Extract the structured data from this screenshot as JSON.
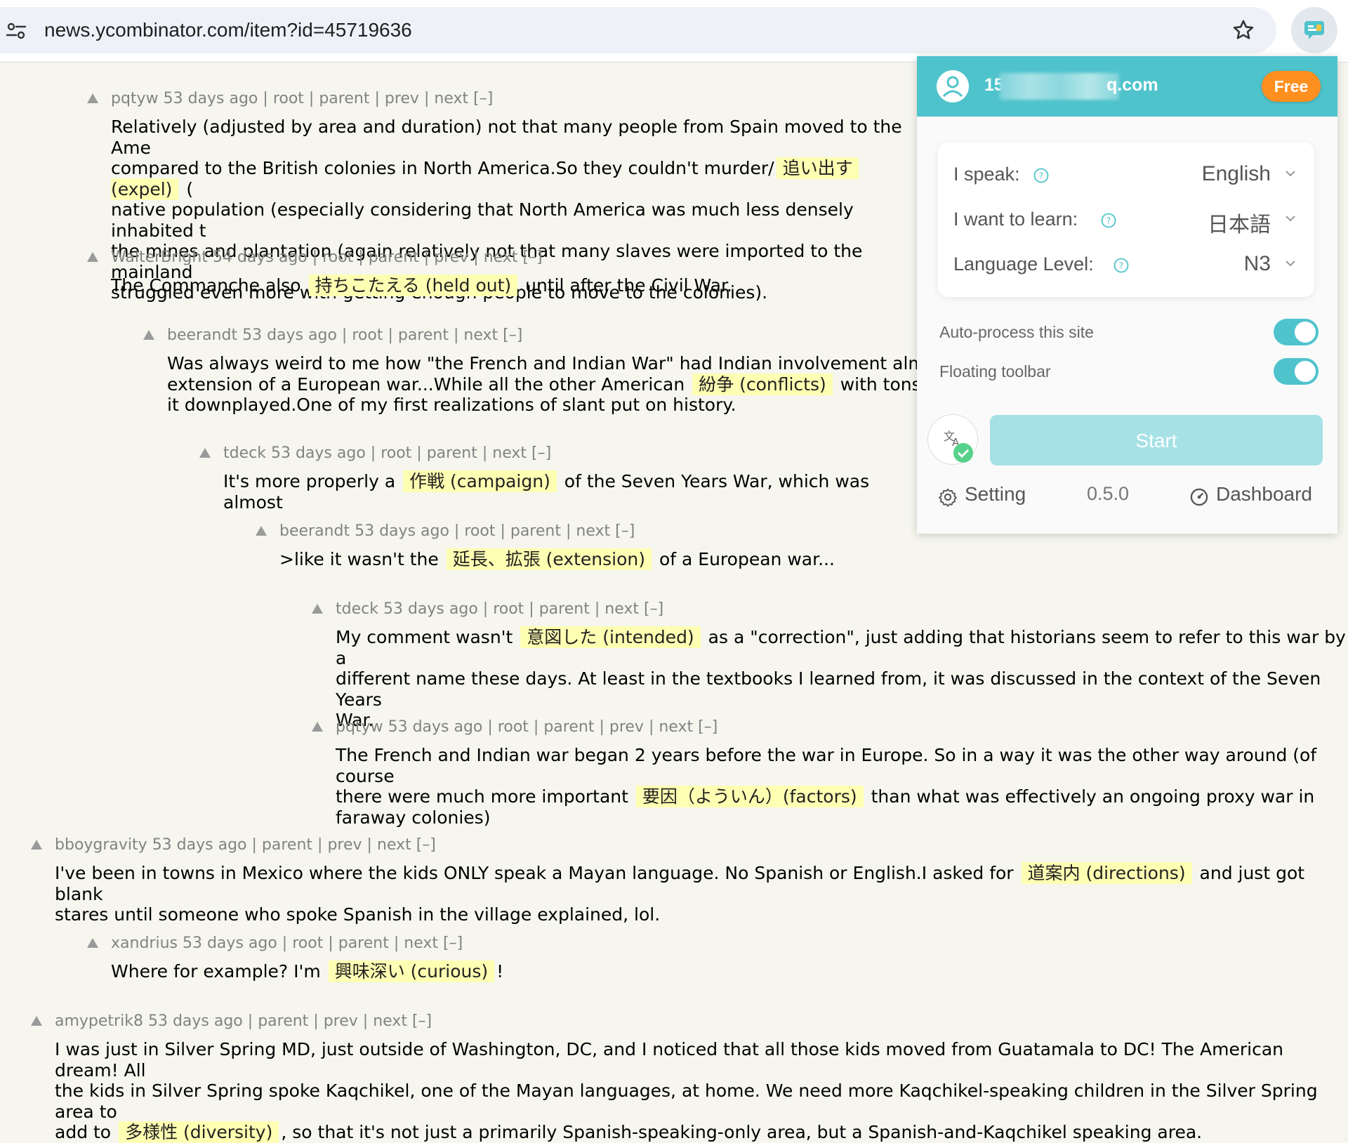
{
  "browser": {
    "url": "news.ycombinator.com/item?id=45719636"
  },
  "comments": [
    {
      "user": "pqtyw",
      "age": "53 days ago",
      "links": [
        "root",
        "parent",
        "prev",
        "next"
      ],
      "toggle": "[–]",
      "body": [
        {
          "t": "Relatively (adjusted by area and duration) not that many people from Spain moved to the Ame\ncompared to the British colonies in North America.So they couldn't murder/"
        },
        {
          "hl": "追い出す (expel)"
        },
        {
          "t": " (\nnative population (especially considering that North America was much less densely inhabited t\nthe mines and plantation (again relatively not that many slaves were imported to the mainland\nstruggled even more with getting enough people to move to the colonies)."
        }
      ]
    },
    {
      "user": "WalterBright",
      "age": "54 days ago",
      "links": [
        "root",
        "parent",
        "prev",
        "next"
      ],
      "toggle": "[–]",
      "body": [
        {
          "t": "The Commanche also "
        },
        {
          "hl": "持ちこたえる (held out)"
        },
        {
          "t": " until after the Civil War."
        }
      ]
    },
    {
      "user": "beerandt",
      "age": "53 days ago",
      "links": [
        "root",
        "parent",
        "next"
      ],
      "toggle": "[–]",
      "body": [
        {
          "t": "Was always weird to me how \"the French and Indian War\" had Indian involvement almos\nextension of a European war...While all the other American "
        },
        {
          "hl": "紛争 (conflicts)"
        },
        {
          "t": " with tons of\nit downplayed.One of my first realizations of slant put on history."
        }
      ]
    },
    {
      "user": "tdeck",
      "age": "53 days ago",
      "links": [
        "root",
        "parent",
        "next"
      ],
      "toggle": "[–]",
      "body": [
        {
          "t": "It's more properly a "
        },
        {
          "hl": "作戦 (campaign)"
        },
        {
          "t": " of the Seven Years War, which was almost"
        }
      ]
    },
    {
      "user": "beerandt",
      "age": "53 days ago",
      "links": [
        "root",
        "parent",
        "next"
      ],
      "toggle": "[–]",
      "body": [
        {
          "t": ">like it wasn't the "
        },
        {
          "hl": "延長、拡張 (extension)"
        },
        {
          "t": " of a European war..."
        }
      ]
    },
    {
      "user": "tdeck",
      "age": "53 days ago",
      "links": [
        "root",
        "parent",
        "next"
      ],
      "toggle": "[–]",
      "body": [
        {
          "t": "My comment wasn't "
        },
        {
          "hl": "意図した (intended)"
        },
        {
          "t": " as a \"correction\", just adding that historians seem to refer to this war by a\ndifferent name these days. At least in the textbooks I learned from, it was discussed in the context of the Seven Years\nWar."
        }
      ]
    },
    {
      "user": "pqtyw",
      "age": "53 days ago",
      "links": [
        "root",
        "parent",
        "prev",
        "next"
      ],
      "toggle": "[–]",
      "body": [
        {
          "t": "The French and Indian war began 2 years before the war in Europe. So in a way it was the other way around (of course\nthere were much more important "
        },
        {
          "hl": "要因（よういん）(factors)"
        },
        {
          "t": " than what was effectively an ongoing proxy war in\nfaraway colonies)"
        }
      ]
    },
    {
      "user": "bboygravity",
      "age": "53 days ago",
      "links": [
        "parent",
        "prev",
        "next"
      ],
      "toggle": "[–]",
      "body": [
        {
          "t": "I've been in towns in Mexico where the kids ONLY speak a Mayan language. No Spanish or English.I asked for "
        },
        {
          "hl": "道案内 (directions)"
        },
        {
          "t": " and just got blank\nstares until someone who spoke Spanish in the village explained, lol."
        }
      ]
    },
    {
      "user": "xandrius",
      "age": "53 days ago",
      "links": [
        "root",
        "parent",
        "next"
      ],
      "toggle": "[–]",
      "body": [
        {
          "t": "Where for example? I'm "
        },
        {
          "hl": "興味深い (curious)"
        },
        {
          "t": "!"
        }
      ]
    },
    {
      "user": "amypetrik8",
      "age": "53 days ago",
      "links": [
        "parent",
        "prev",
        "next"
      ],
      "toggle": "[–]",
      "body": [
        {
          "t": "I was just in Silver Spring MD, just outside of Washington, DC, and I noticed that all those kids moved from Guatamala to DC! The American dream! All\nthe kids in Silver Spring spoke Kaqchikel, one of the Mayan languages, at home. We need more Kaqchikel-speaking children in the Silver Spring area to\nadd to "
        },
        {
          "hl": "多様性 (diversity)"
        },
        {
          "t": ", so that it's not just a primarily Spanish-speaking-only area, but a Spanish-and-Kaqchikel speaking area."
        }
      ]
    }
  ],
  "popup": {
    "email_head": "15",
    "email_tail": "q.com",
    "plan": "Free",
    "settings": {
      "speak_label": "I speak:",
      "speak_value": "English",
      "learn_label": "I want to learn:",
      "learn_value": "日本語",
      "level_label": "Language Level:",
      "level_value": "N3"
    },
    "toggles": {
      "auto_process_label": "Auto-process this site",
      "auto_process_on": true,
      "floating_toolbar_label": "Floating toolbar",
      "floating_toolbar_on": true
    },
    "start_label": "Start",
    "footer": {
      "setting_label": "Setting",
      "version": "0.5.0",
      "dashboard_label": "Dashboard"
    },
    "accent_color": "#4fc3cc",
    "badge_color": "#ff8f1f"
  }
}
